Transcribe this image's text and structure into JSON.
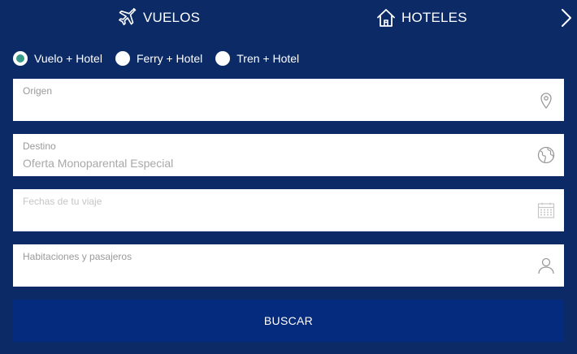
{
  "tabs": {
    "flights": {
      "label": "VUELOS",
      "icon": "airplane-icon"
    },
    "hotels": {
      "label": "HOTELES",
      "icon": "house-icon"
    },
    "next": {
      "icon": "chevron-right-icon"
    }
  },
  "trip_type": {
    "selected": "Vuelo + Hotel",
    "options": [
      {
        "label": "Vuelo + Hotel",
        "checked": true
      },
      {
        "label": "Ferry + Hotel",
        "checked": false
      },
      {
        "label": "Tren + Hotel",
        "checked": false
      }
    ]
  },
  "fields": {
    "origin": {
      "label": "Origen",
      "value": "",
      "placeholder": "",
      "icon": "map-pin-icon"
    },
    "destination": {
      "label": "Destino",
      "value": "",
      "placeholder": "Oferta Monoparental Especial",
      "icon": "globe-icon"
    },
    "dates": {
      "label": "Fechas de tu viaje",
      "value": "",
      "placeholder": "",
      "icon": "calendar-icon"
    },
    "rooms": {
      "label": "Habitaciones y pasajeros",
      "value": "",
      "placeholder": "",
      "icon": "user-icon"
    }
  },
  "search": {
    "label": "BUSCAR"
  },
  "colors": {
    "background": "#0b2a66",
    "button": "#042b7e",
    "radio_checked": "#3a9a8a",
    "field_label": "#9a9a9a",
    "icon": "#9a9a9a"
  }
}
